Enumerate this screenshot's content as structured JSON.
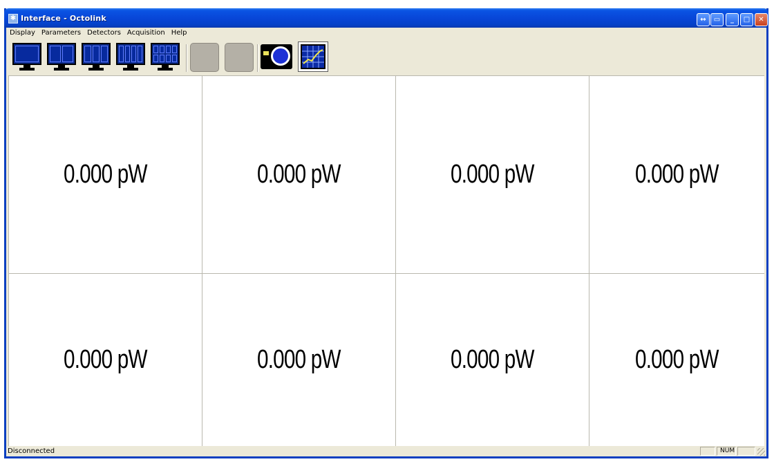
{
  "window": {
    "title": "Interface - Octolink"
  },
  "menu": {
    "items": [
      "Display",
      "Parameters",
      "Detectors",
      "Acquisition",
      "Help"
    ]
  },
  "toolbar": {
    "layout_buttons": [
      {
        "icon": "single-monitor-icon",
        "panes": 1
      },
      {
        "icon": "two-pane-monitor-icon",
        "panes": 2
      },
      {
        "icon": "three-pane-monitor-icon",
        "panes": 3
      },
      {
        "icon": "four-pane-monitor-icon",
        "panes": 4
      },
      {
        "icon": "eight-pane-monitor-icon",
        "panes": 8
      }
    ],
    "disabled_buttons": 2,
    "camera_icon": "camera-icon",
    "graph_icon": "graph-icon"
  },
  "readings": [
    {
      "value": "0.000 pW"
    },
    {
      "value": "0.000 pW"
    },
    {
      "value": "0.000 pW"
    },
    {
      "value": "0.000 pW"
    },
    {
      "value": "0.000 pW"
    },
    {
      "value": "0.000 pW"
    },
    {
      "value": "0.000 pW"
    },
    {
      "value": "0.000 pW"
    }
  ],
  "status": {
    "text": "Disconnected",
    "num": "NUM"
  },
  "colors": {
    "titlebar": "#0846d8",
    "window_bg": "#ece9d8",
    "screen_blue": "#0a2a8c"
  }
}
